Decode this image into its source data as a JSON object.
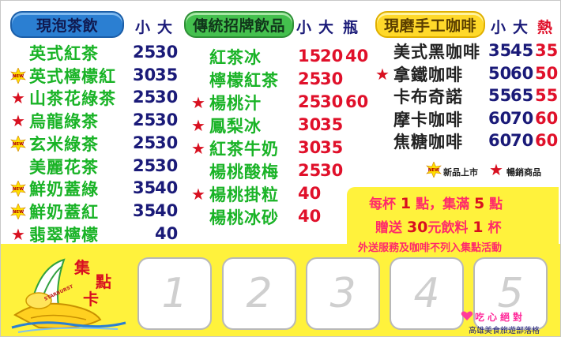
{
  "sections": {
    "tea": {
      "title": "現泡茶飲",
      "headers": [
        "小",
        "大"
      ],
      "items": [
        {
          "mark": "",
          "name": "英式紅茶",
          "prices": [
            "25",
            "30"
          ]
        },
        {
          "mark": "new",
          "name": "英式檸檬紅",
          "prices": [
            "30",
            "35"
          ]
        },
        {
          "mark": "hot",
          "name": "山茶花綠茶",
          "prices": [
            "25",
            "30"
          ]
        },
        {
          "mark": "hot",
          "name": "烏龍綠茶",
          "prices": [
            "25",
            "30"
          ]
        },
        {
          "mark": "new",
          "name": "玄米綠茶",
          "prices": [
            "25",
            "30"
          ]
        },
        {
          "mark": "",
          "name": "美麗花茶",
          "prices": [
            "25",
            "30"
          ]
        },
        {
          "mark": "new",
          "name": "鮮奶蓋綠",
          "prices": [
            "35",
            "40"
          ]
        },
        {
          "mark": "new",
          "name": "鮮奶蓋紅",
          "prices": [
            "35",
            "40"
          ]
        },
        {
          "mark": "hot",
          "name": "翡翠檸檬",
          "prices": [
            "",
            "40"
          ]
        }
      ]
    },
    "traditional": {
      "title": "傳統招牌飲品",
      "headers": [
        "小",
        "大",
        "瓶"
      ],
      "items": [
        {
          "mark": "",
          "name": "紅茶冰",
          "prices": [
            "15",
            "20",
            "40"
          ]
        },
        {
          "mark": "",
          "name": "檸檬紅茶",
          "prices": [
            "25",
            "30",
            ""
          ]
        },
        {
          "mark": "hot",
          "name": "楊桃汁",
          "prices": [
            "25",
            "30",
            "60"
          ]
        },
        {
          "mark": "hot",
          "name": "鳳梨冰",
          "prices": [
            "30",
            "35",
            ""
          ]
        },
        {
          "mark": "hot",
          "name": "紅茶牛奶",
          "prices": [
            "30",
            "35",
            ""
          ]
        },
        {
          "mark": "",
          "name": "楊桃酸梅",
          "prices": [
            "25",
            "30",
            ""
          ]
        },
        {
          "mark": "hot",
          "name": "楊桃掛粒",
          "prices": [
            "40",
            "",
            ""
          ]
        },
        {
          "mark": "",
          "name": "楊桃冰砂",
          "prices": [
            "40",
            "",
            ""
          ]
        }
      ]
    },
    "coffee": {
      "title": "現磨手工咖啡",
      "headers": [
        "小",
        "大",
        "熱"
      ],
      "items": [
        {
          "mark": "",
          "name": "美式黑咖啡",
          "prices": [
            "35",
            "45",
            "35"
          ]
        },
        {
          "mark": "hot",
          "name": "拿鐵咖啡",
          "prices": [
            "50",
            "60",
            "50"
          ]
        },
        {
          "mark": "",
          "name": "卡布奇諾",
          "prices": [
            "55",
            "65",
            "55"
          ]
        },
        {
          "mark": "",
          "name": "摩卡咖啡",
          "prices": [
            "60",
            "70",
            "60"
          ]
        },
        {
          "mark": "",
          "name": "焦糖咖啡",
          "prices": [
            "60",
            "70",
            "60"
          ]
        }
      ]
    }
  },
  "legend": {
    "new_label": "新品上市",
    "new_badge": "NEW",
    "hot_label": "暢銷商品"
  },
  "promo": {
    "line1_a": "每杯",
    "line1_n1": "1",
    "line1_b": "點，集滿",
    "line1_n2": "5",
    "line1_c": "點",
    "line2_a": "贈送",
    "line2_n1": "30",
    "line2_b": "元飲料",
    "line2_n2": "1",
    "line2_c": "杯",
    "line3": "外送服務及咖啡不列入集點活動"
  },
  "stamp": {
    "title_chars": [
      "集",
      "點",
      "卡"
    ],
    "slots": [
      "1",
      "2",
      "3",
      "4",
      "5"
    ],
    "fruit_label": "STARBURST"
  },
  "footer": {
    "brand": "吃心絕對",
    "sub": "高雄美食旅遊部落格"
  },
  "colors": {
    "navy": "#1a1a78",
    "red": "#e0102a",
    "green": "#19b326",
    "yellow": "#fff23c",
    "pink": "#ff2a6a"
  }
}
